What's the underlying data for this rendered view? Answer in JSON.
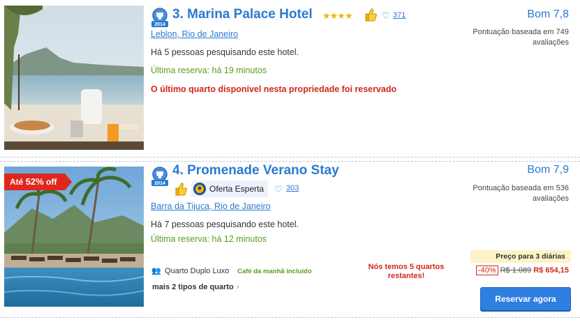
{
  "hotels": [
    {
      "title": "3. Marina Palace Hotel",
      "award_year": "2014",
      "stars": "★★★★",
      "favorites_count": "371",
      "location": "Leblon, Rio de Janeiro",
      "searching": "Há 5 pessoas pesquisando este hotel.",
      "last_booking": "Última reserva: há 19 minutos",
      "alert": "O último quarto disponível nesta propriedade foi reservado",
      "score": "Bom 7,8",
      "score_note": "Pontuação baseada em 749 avaliações"
    },
    {
      "title": "4. Promenade Verano Stay",
      "award_year": "2014",
      "ribbon_prefix": "Até ",
      "ribbon_percent": "52%",
      "ribbon_suffix": " off",
      "deal_label": "Oferta Esperta",
      "favorites_count": "303",
      "location": "Barra da Tijuca, Rio de Janeiro",
      "searching": "Há 7 pessoas pesquisando este hotel.",
      "last_booking": "Última reserva: há 12 minutos",
      "score": "Bom 7,9",
      "score_note": "Pontuação baseada em 536 avaliações",
      "room_type": "Quarto Duplo Luxo",
      "breakfast": "Café da manhã incluído",
      "more_rooms": "mais 2 tipos de quarto",
      "rooms_left": "Nós temos 5 quartos restantes!",
      "price_label": "Preço para 3 diárias",
      "discount": "-40%",
      "old_price": "R$ 1.089",
      "new_price": "R$ 654,15",
      "book_button": "Reservar agora"
    }
  ],
  "colors": {
    "accent": "#2a7ad2",
    "alert_red": "#d0281d",
    "green": "#5a9c1c",
    "button": "#2f7fe0",
    "star": "#f2b308"
  },
  "icons": [
    "award-badge-icon",
    "thumbs-up-icon",
    "heart-icon",
    "smart-deal-icon",
    "people-icon",
    "chevron-right-icon"
  ]
}
